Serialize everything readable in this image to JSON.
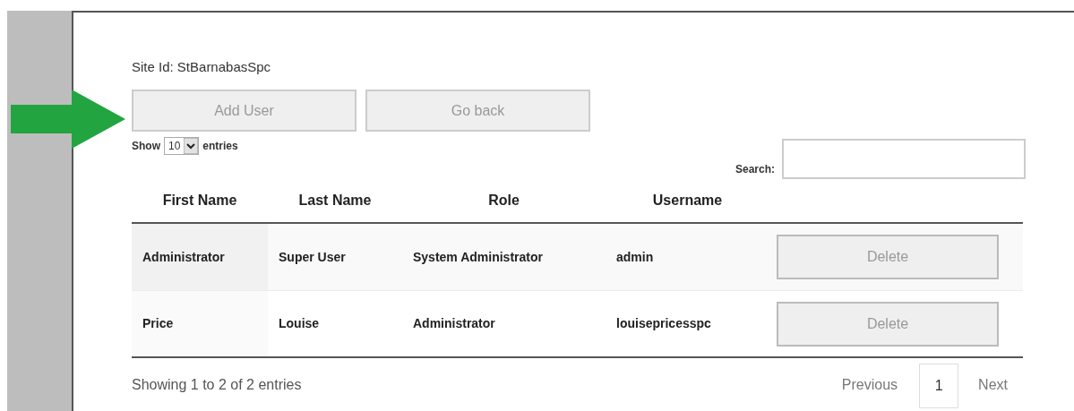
{
  "site_id": "Site Id: StBarnabasSpc",
  "buttons": [
    "Add User",
    "Go back"
  ],
  "length_menu": {
    "before": "Show",
    "value": "10",
    "after": "entries"
  },
  "search": {
    "label": "Search:"
  },
  "table": {
    "columns": [
      "First Name",
      "Last Name",
      "Role",
      "Username"
    ],
    "rows": [
      {
        "cells": [
          "Administrator",
          "Super User",
          "System Administrator",
          "admin"
        ],
        "action": "Delete"
      },
      {
        "cells": [
          "Price",
          "Louise",
          "Administrator",
          "louisepricesspc"
        ],
        "action": "Delete"
      }
    ]
  },
  "info": "Showing 1 to 2 of 2 entries",
  "pagination": {
    "previous": "Previous",
    "pages": [
      {
        "label": "1",
        "selected": true
      }
    ],
    "next": "Next"
  }
}
